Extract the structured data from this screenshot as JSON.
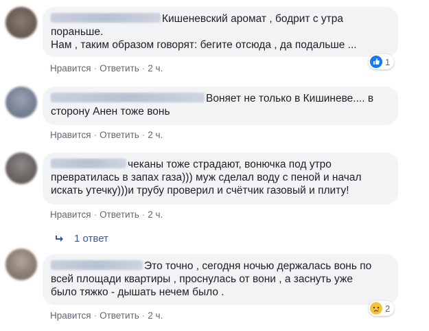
{
  "comments": [
    {
      "lines": [
        "Кишеневский аромат , бодрит с утра",
        "пораньше.",
        "Нам , таким образом говорят: бегите отсюда , да подальше ..."
      ],
      "like_label": "Нравится",
      "reply_label": "Ответить",
      "time": "2 ч.",
      "reaction": {
        "icon": "like-icon",
        "count": "1"
      }
    },
    {
      "lines": [
        "Воняет не только в Кишиневе.... в",
        "сторону Анен тоже вонь"
      ],
      "like_label": "Нравится",
      "reply_label": "Ответить",
      "time": "2 ч."
    },
    {
      "lines": [
        "чеканы тоже страдают, вонючка под утро",
        "превратилась в запах газа))) муж сделал воду с пеной и начал",
        "искать утечку)))и трубу проверил и счётчик газовый и плиту!"
      ],
      "like_label": "Нравится",
      "reply_label": "Ответить",
      "time": "2 ч.",
      "replies_label": "1 ответ"
    },
    {
      "lines": [
        "Это точно , сегодня ночью держалась вонь по",
        "всей площади квартиры , проснулась от вони , а заснуть уже",
        "было тяжко - дышать нечем было ."
      ],
      "like_label": "Нравится",
      "reply_label": "Ответить",
      "time": "2 ч.",
      "reaction": {
        "icon": "sad-icon",
        "count": "2"
      }
    }
  ],
  "colors": {
    "bubble_bg": "#f2f3f5",
    "text": "#1c1e21",
    "meta": "#606770",
    "link": "#385898",
    "like_blue": "#1877f2",
    "sad_yellow": "#f5c33b"
  }
}
